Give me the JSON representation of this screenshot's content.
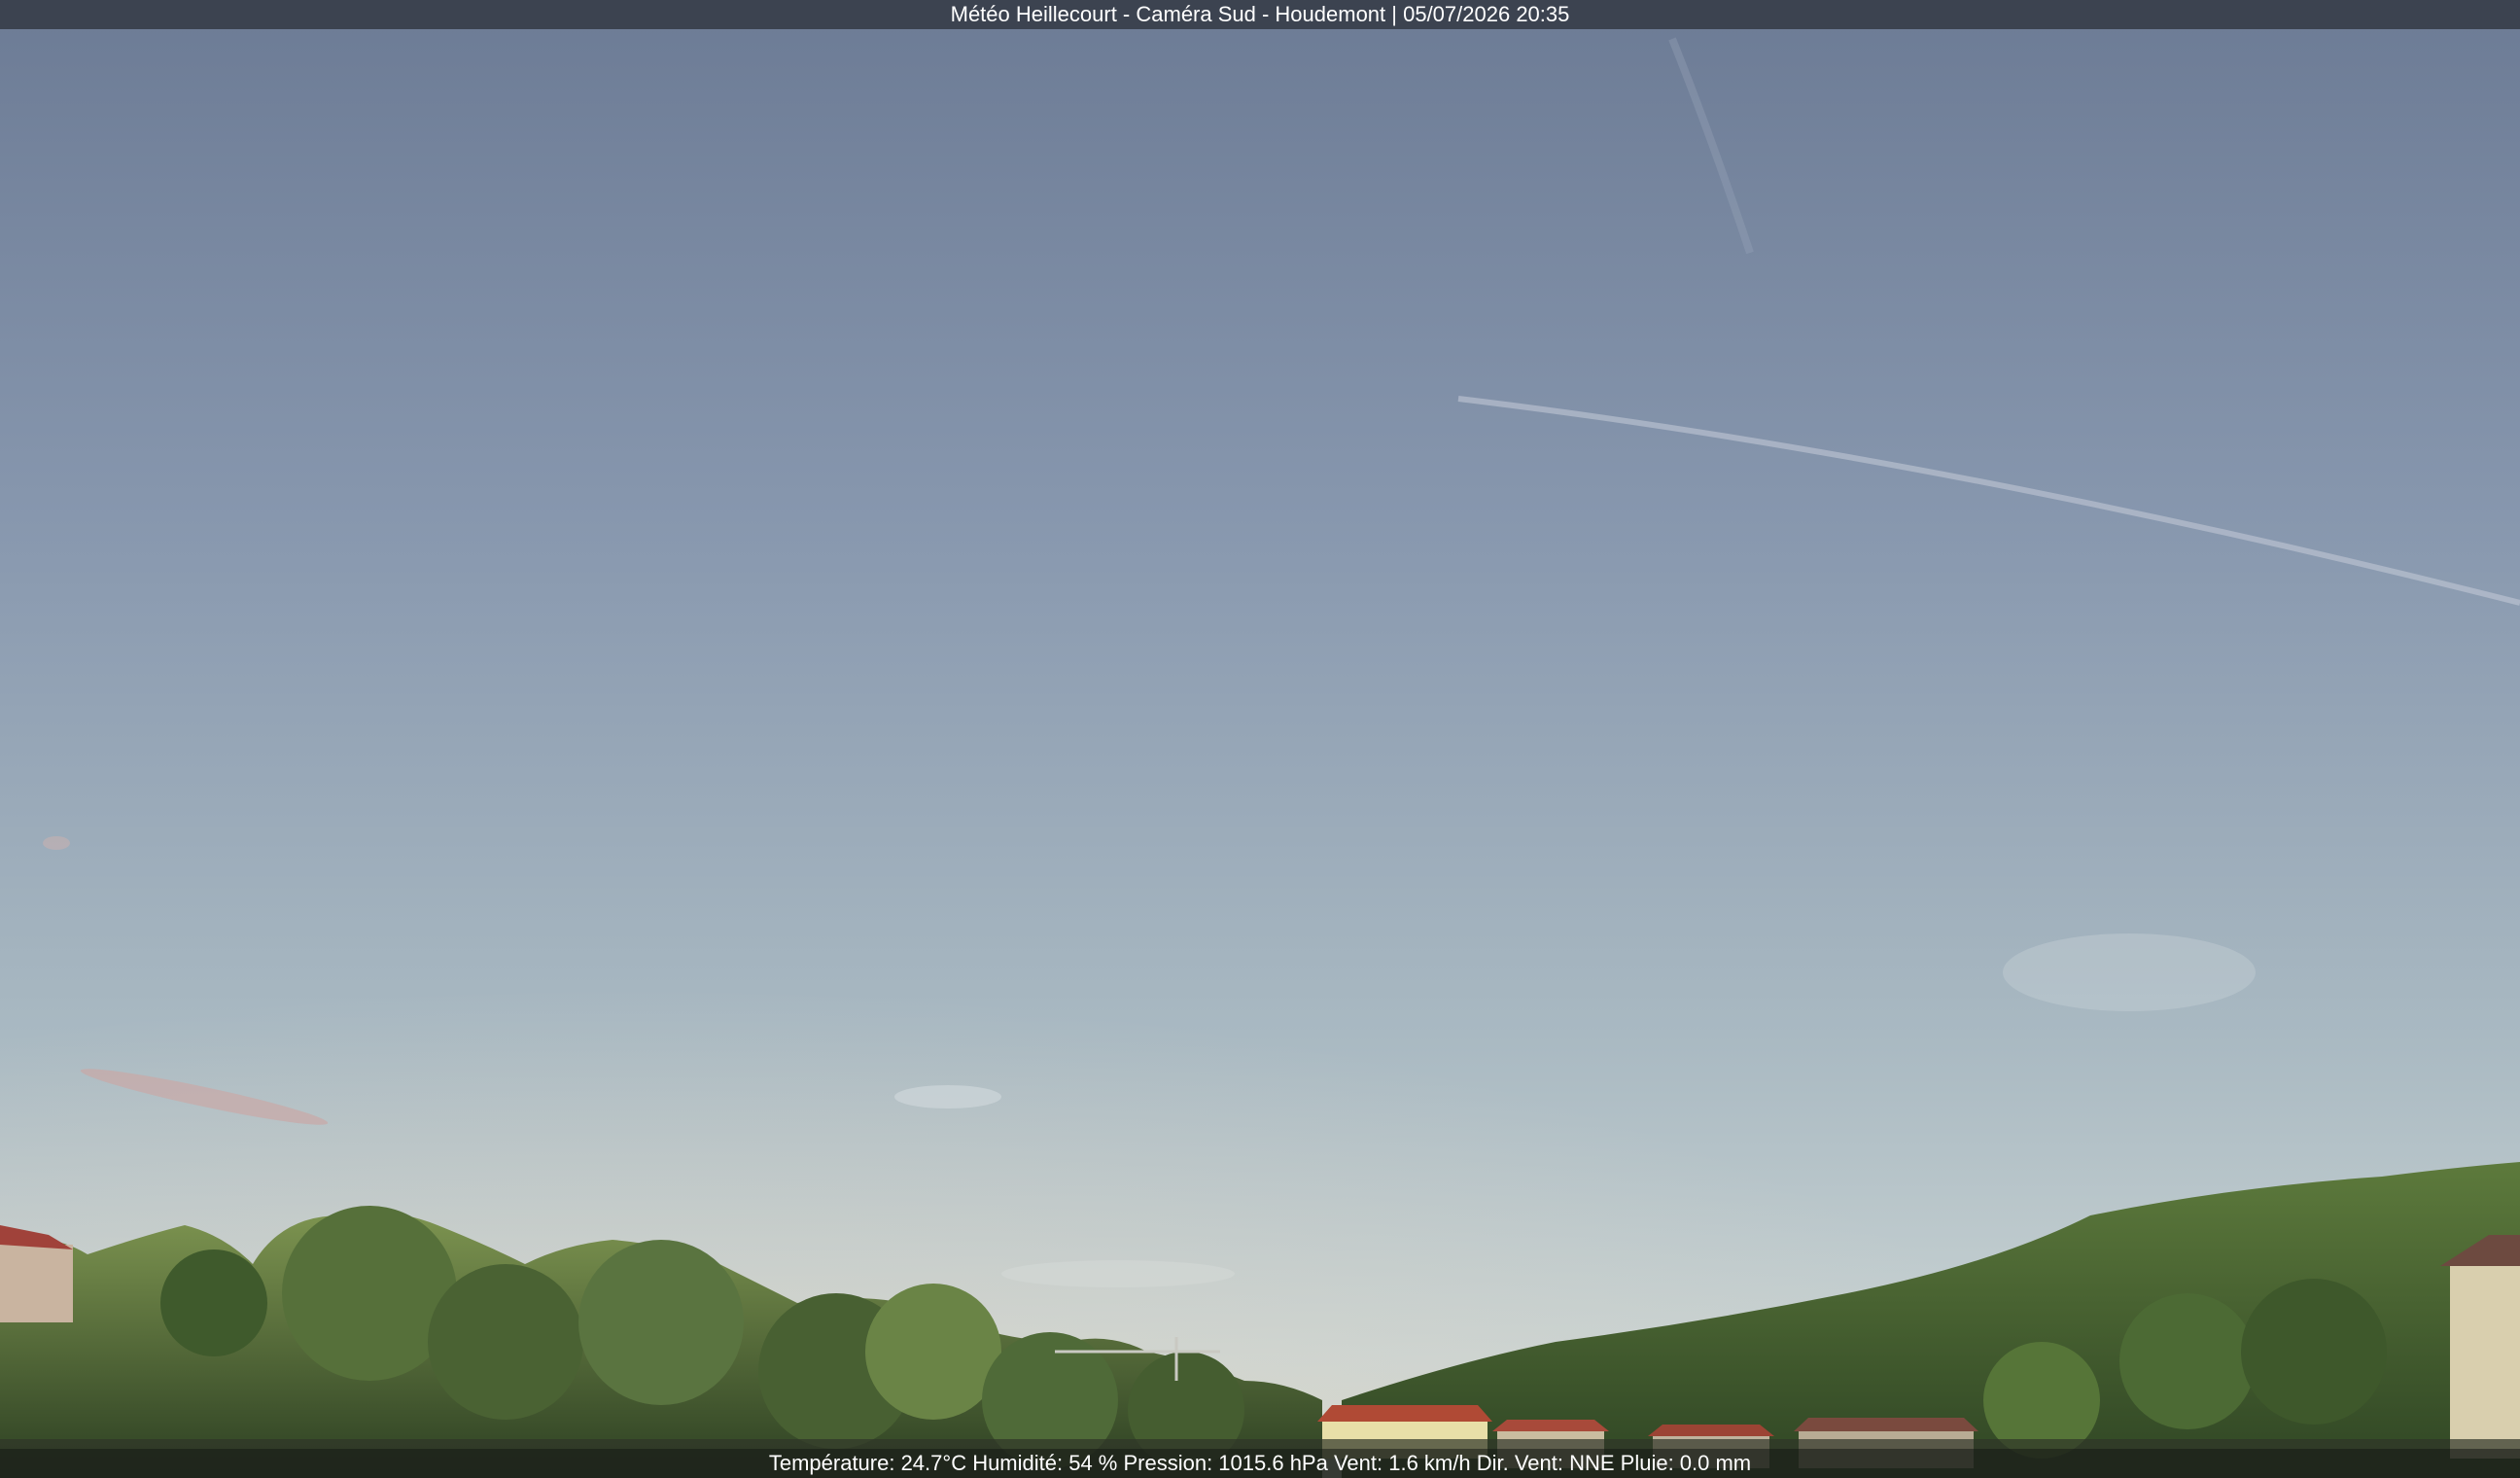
{
  "camera": {
    "title": "Météo Heillecourt - Caméra Sud - Houdemont | 05/07/2026 20:35"
  },
  "weather": {
    "readout": "Température: 24.7°C  Humidité: 54 % Pression: 1015.6 hPa Vent: 1.6 km/h Dir. Vent: NNE Pluie: 0.0 mm"
  },
  "colors": {
    "sky_top": "#6e7d97",
    "sky_mid": "#92a4b8",
    "sky_horizon": "#c2cfd4",
    "vegetation": "#3d5a2a",
    "roofs": "#b04a35"
  }
}
